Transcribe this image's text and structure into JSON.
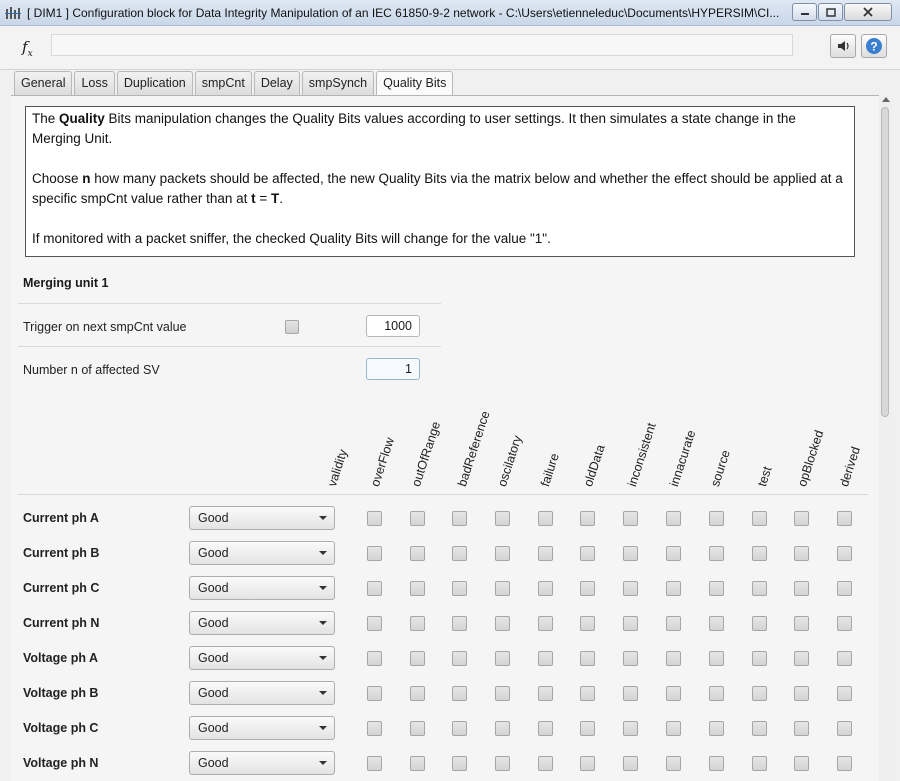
{
  "window": {
    "title": "[ DIM1 ]  Configuration block for Data Integrity Manipulation of an IEC 61850-9-2 network - C:\\Users\\etienneleduc\\Documents\\HYPERSIM\\CI..."
  },
  "tabs": [
    "General",
    "Loss",
    "Duplication",
    "smpCnt",
    "Delay",
    "smpSynch",
    "Quality Bits"
  ],
  "active_tab": "Quality Bits",
  "description": {
    "p1": {
      "a": "The ",
      "b": "Quality",
      "c": " Bits manipulation changes the Quality Bits values according to user settings. It then simulates a state change in the Merging Unit."
    },
    "p2": {
      "a": "Choose ",
      "b": "n",
      "c": " how many packets should be affected, the new Quality Bits via the matrix below and whether the effect should be applied at a specific smpCnt value rather than at ",
      "d": "t",
      "e": " = ",
      "f": "T",
      "g": "."
    },
    "p3": "If monitored with a packet sniffer, the checked Quality Bits will change for the value \"1\"."
  },
  "merging_unit": {
    "title": "Merging unit 1",
    "trigger_label": "Trigger on next smpCnt value",
    "trigger_checked": false,
    "trigger_value": "1000",
    "affected_label": "Number n of affected SV",
    "affected_value": "1"
  },
  "quality_columns": [
    "validity",
    "overFlow",
    "outOfRange",
    "badReference",
    "oscilatory",
    "failure",
    "oldData",
    "inconsistent",
    "innacurate",
    "source",
    "test",
    "opBlocked",
    "derived"
  ],
  "rows": [
    {
      "label": "Current ph A",
      "state": "Good"
    },
    {
      "label": "Current ph B",
      "state": "Good"
    },
    {
      "label": "Current ph C",
      "state": "Good"
    },
    {
      "label": "Current ph N",
      "state": "Good"
    },
    {
      "label": "Voltage ph A",
      "state": "Good"
    },
    {
      "label": "Voltage ph B",
      "state": "Good"
    },
    {
      "label": "Voltage ph C",
      "state": "Good"
    },
    {
      "label": "Voltage ph N",
      "state": "Good"
    }
  ],
  "icons": {
    "app": "signal-bars-icon",
    "formula": "fx-icon",
    "signal": "signal-wave-icon",
    "help": "help-icon"
  },
  "colors": {
    "titlebar": "#c9d7ea",
    "help_blue": "#3a7fcf"
  }
}
